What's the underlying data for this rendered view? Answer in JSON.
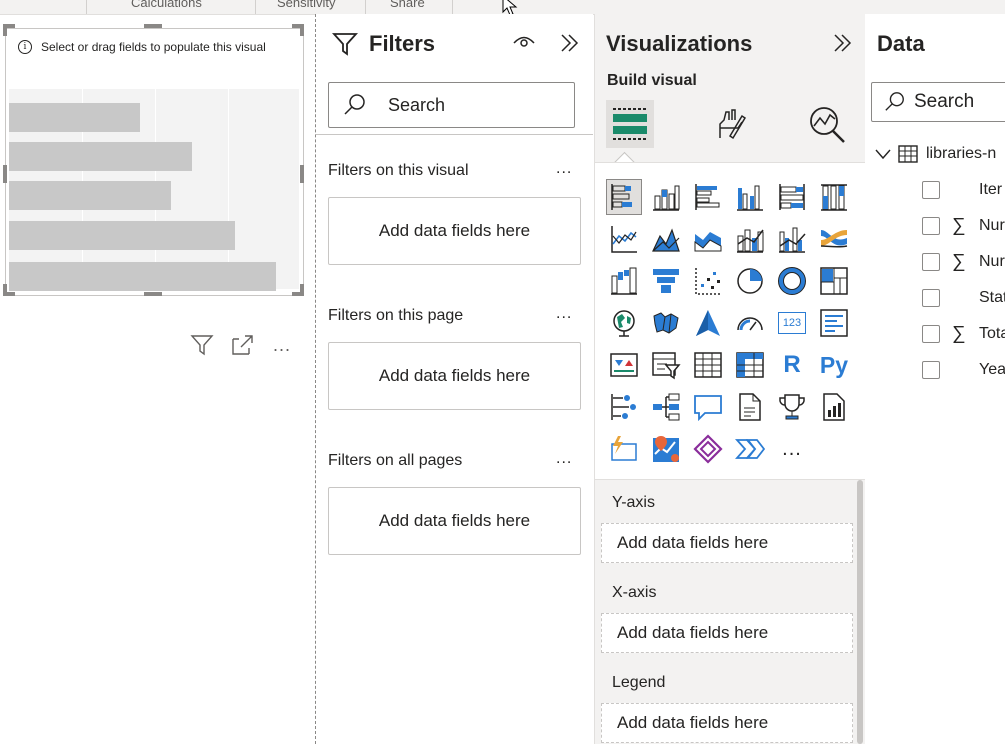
{
  "ribbon": {
    "tabs": [
      "Calculations",
      "Sensitivity",
      "Share"
    ]
  },
  "visual": {
    "hint": "Select or drag fields to populate this visual",
    "bar_fractions": [
      0.45,
      0.63,
      0.56,
      0.78,
      0.92
    ]
  },
  "filters": {
    "title": "Filters",
    "search_placeholder": "Search",
    "sections": [
      {
        "label": "Filters on this visual",
        "drop": "Add data fields here"
      },
      {
        "label": "Filters on this page",
        "drop": "Add data fields here"
      },
      {
        "label": "Filters on all pages",
        "drop": "Add data fields here"
      }
    ],
    "more": "..."
  },
  "visualizations": {
    "title": "Visualizations",
    "build_label": "Build visual",
    "icon_rows": [
      [
        "stacked-bar-chart-icon",
        "stacked-column-chart-icon",
        "clustered-bar-chart-icon",
        "clustered-column-chart-icon",
        "100-stacked-bar-chart-icon",
        "100-stacked-column-chart-icon"
      ],
      [
        "line-chart-icon",
        "area-chart-icon",
        "stacked-area-chart-icon",
        "line-and-stacked-column-icon",
        "line-and-clustered-column-icon",
        "ribbon-chart-icon"
      ],
      [
        "waterfall-chart-icon",
        "funnel-icon",
        "scatter-chart-icon",
        "pie-chart-icon",
        "donut-chart-icon",
        "treemap-icon"
      ],
      [
        "map-icon",
        "filled-map-icon",
        "azure-map-icon",
        "gauge-icon",
        "card-icon",
        "multi-row-card-icon"
      ],
      [
        "kpi-icon",
        "slicer-icon",
        "table-icon",
        "matrix-icon",
        "r-visual-icon",
        "python-visual-icon"
      ],
      [
        "key-influencers-icon",
        "decomposition-tree-icon",
        "qa-icon",
        "smart-narrative-icon",
        "metrics-icon",
        "paginated-report-icon"
      ],
      [
        "power-apps-icon",
        "arcgis-map-icon",
        "power-automate-icon",
        "power-apps-forms-icon",
        "more-visuals-icon"
      ]
    ],
    "r_label": "R",
    "py_label": "Py",
    "card_label": "123",
    "more_label": "...",
    "wells": [
      {
        "label": "Y-axis",
        "drop": "Add data fields here"
      },
      {
        "label": "X-axis",
        "drop": "Add data fields here"
      },
      {
        "label": "Legend",
        "drop": "Add data fields here"
      }
    ]
  },
  "data_pane": {
    "title": "Data",
    "search_placeholder": "Search",
    "table_name": "libraries-n",
    "fields": [
      {
        "name": "Iter",
        "sigma": false
      },
      {
        "name": "Nur",
        "sigma": true
      },
      {
        "name": "Nur",
        "sigma": true
      },
      {
        "name": "Stat",
        "sigma": false
      },
      {
        "name": "Tota",
        "sigma": true
      },
      {
        "name": "Yea",
        "sigma": false
      }
    ]
  },
  "colors": {
    "accent_blue": "#2b7cd3",
    "selected_green": "#1a8a6a",
    "pane_bg": "#f3f2f1",
    "bar_gray": "#c8c8c8"
  }
}
